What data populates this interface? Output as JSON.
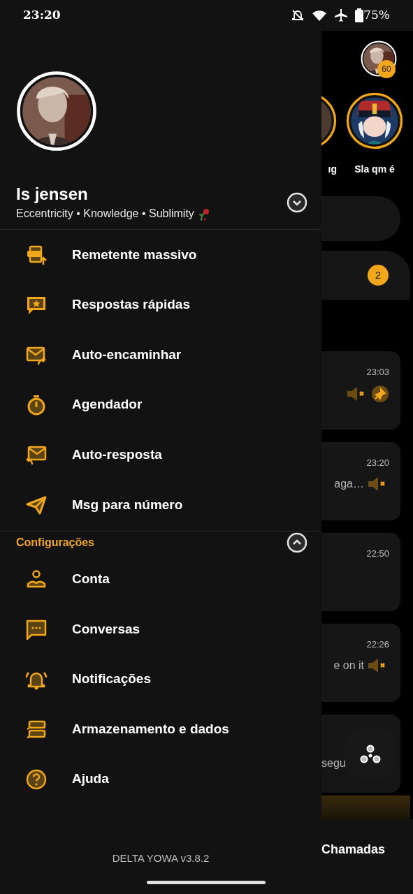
{
  "status_bar": {
    "time": "23:20",
    "battery": "75%"
  },
  "profile": {
    "name": "Is jensen",
    "bio": "Eccentricity • Knowledge • Sublimity",
    "expanded": false
  },
  "tools": [
    {
      "kind": "csv",
      "label": "Remetente massivo"
    },
    {
      "kind": "quick-reply",
      "label": "Respostas rápidas"
    },
    {
      "kind": "forward",
      "label": "Auto-encaminhar"
    },
    {
      "kind": "timer",
      "label": "Agendador"
    },
    {
      "kind": "auto-reply",
      "label": "Auto-resposta"
    },
    {
      "kind": "send",
      "label": "Msg para número"
    }
  ],
  "settings": {
    "title": "Configurações",
    "expanded": true,
    "items": [
      {
        "kind": "account",
        "label": "Conta"
      },
      {
        "kind": "chat",
        "label": "Conversas"
      },
      {
        "kind": "bell",
        "label": "Notificações"
      },
      {
        "kind": "storage",
        "label": "Armazenamento e dados"
      },
      {
        "kind": "help",
        "label": "Ajuda"
      }
    ]
  },
  "footer": "DELTA YOWA v3.8.2",
  "background": {
    "status_count": "60",
    "stories": [
      {
        "label": "ıg"
      },
      {
        "label": "Sla qm é"
      }
    ],
    "unread_count": "2",
    "chats": [
      {
        "time": "23:03",
        "muted": true,
        "pinned": true
      },
      {
        "time": "23:20",
        "preview": "aga…",
        "muted": true,
        "pinned": false
      },
      {
        "time": "22:50",
        "muted": false,
        "pinned": false
      },
      {
        "time": "22:26",
        "preview": "e on it",
        "muted": true,
        "pinned": false
      },
      {
        "preview": "segu"
      }
    ],
    "nav_label": "Chamadas"
  }
}
